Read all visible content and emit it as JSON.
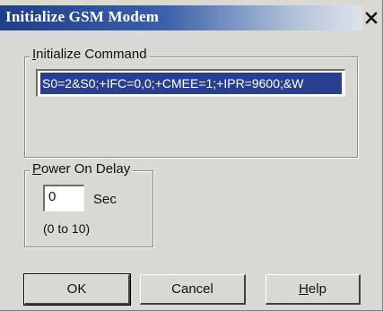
{
  "window": {
    "title": "Initialize GSM Modem",
    "close_symbol": "x"
  },
  "init_group": {
    "label_first": "I",
    "label_rest": "nitialize Command",
    "command_value": "S0=2&S0;+IFC=0,0;+CMEE=1;+IPR=9600;&W"
  },
  "delay_group": {
    "label_first": "P",
    "label_rest": "ower On Delay",
    "value": "0",
    "unit": "Sec",
    "range": "(0 to 10)"
  },
  "buttons": {
    "ok": "OK",
    "cancel": "Cancel",
    "help_first": "H",
    "help_rest": "elp"
  },
  "colors": {
    "title_bar": "#1f3f86",
    "selection": "#2a3f8f",
    "dialog_bg": "#d9d8d3"
  }
}
